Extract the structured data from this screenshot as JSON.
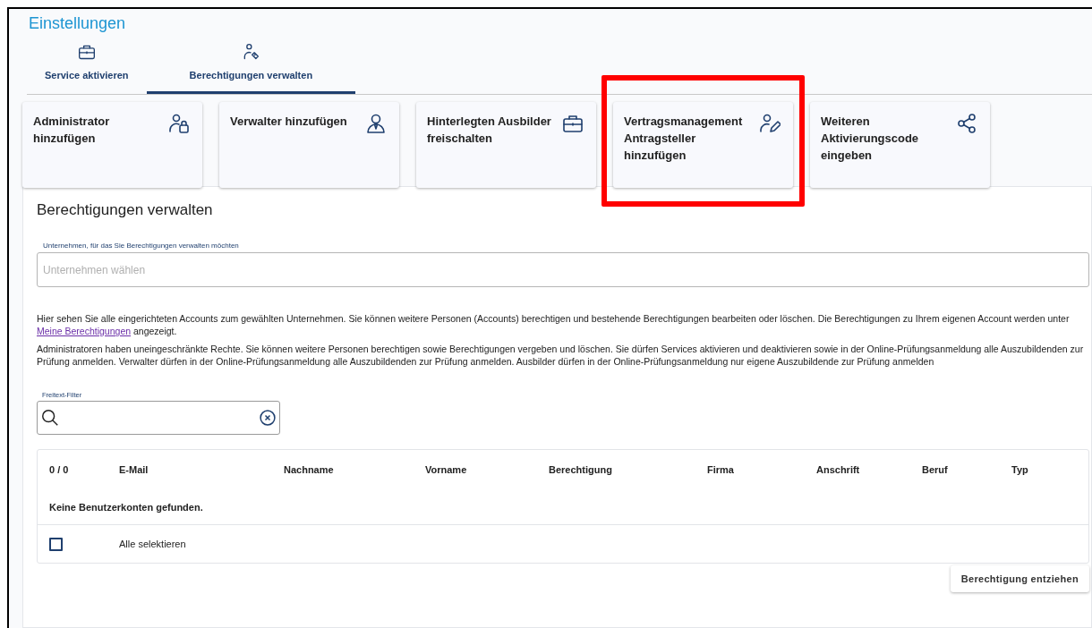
{
  "page_title": "Einstellungen",
  "tabs": [
    {
      "label": "Service aktivieren",
      "kind": "briefcase",
      "selected": false
    },
    {
      "label": "Berechtigungen verwalten",
      "kind": "usertag",
      "selected": true
    }
  ],
  "action_cards": [
    {
      "label": "Administrator hinzufügen",
      "kind": "userlock",
      "highlighted": false
    },
    {
      "label": "Verwalter hinzufügen",
      "kind": "usertie",
      "highlighted": false
    },
    {
      "label": "Hinterlegten Ausbilder freischalten",
      "kind": "briefcase",
      "highlighted": false
    },
    {
      "label": "Vertragsmanagement Antragsteller hinzufügen",
      "kind": "userpen",
      "highlighted": true
    },
    {
      "label": "Weiteren Aktivierungscode eingeben",
      "kind": "share",
      "highlighted": false
    }
  ],
  "panel": {
    "heading": "Berechtigungen verwalten",
    "company_field": {
      "label": "Unternehmen, für das Sie Berechtigungen verwalten möchten",
      "placeholder": "Unternehmen wählen"
    },
    "info_text": {
      "before": "Hier sehen Sie alle eingerichteten Accounts zum gewählten Unternehmen. Sie können weitere Personen (Accounts) berechtigen und bestehende Berechtigungen bearbeiten oder löschen. Die Berechtigungen zu Ihrem eigenen Account werden unter",
      "link": "Meine Berechtigungen",
      "after": "angezeigt."
    },
    "roles_text": "Administratoren haben uneingeschränkte Rechte. Sie können weitere Personen berechtigen sowie Berechtigungen vergeben und löschen. Sie dürfen Services aktivieren und deaktivieren sowie in der Online-Prüfungsanmeldung alle Auszubildenden zur Prüfung anmelden. Verwalter dürfen in der Online-Prüfungsanmeldung alle Auszubildenden zur Prüfung anmelden. Ausbilder dürfen in der Online-Prüfungsanmeldung nur eigene Auszubildende zur Prüfung anmelden",
    "filter": {
      "label": "Freitext-Filter"
    },
    "table": {
      "columns": [
        "0 / 0",
        "E-Mail",
        "Nachname",
        "Vorname",
        "Berechtigung",
        "Firma",
        "Anschrift",
        "Beruf",
        "Typ"
      ],
      "empty_message": "Keine Benutzerkonten gefunden.",
      "select_all": {
        "label": "Alle selektieren",
        "checked": false
      }
    },
    "revoke_button": "Berechtigung entziehen"
  }
}
